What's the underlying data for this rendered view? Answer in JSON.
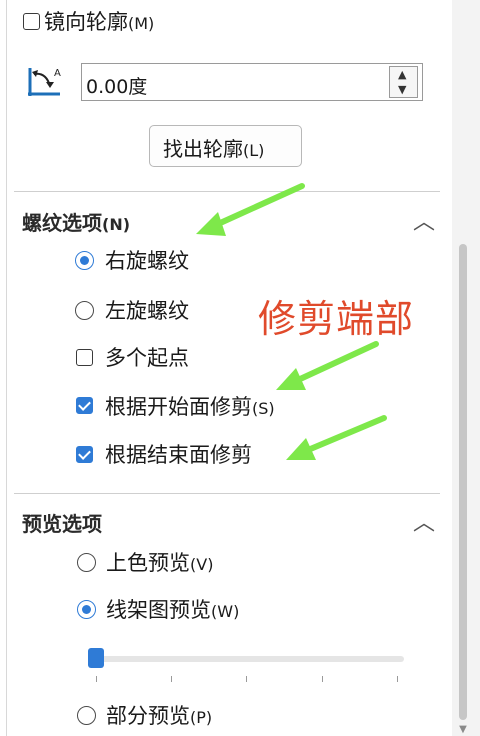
{
  "mirror_profile": {
    "label": "镜向轮廓",
    "shortcut": "(M)",
    "checked": false
  },
  "angle": {
    "value": "0.00度",
    "icon": "angle-icon"
  },
  "find_profile_button": {
    "label": "找出轮廓",
    "shortcut": "(L)"
  },
  "thread_options": {
    "title": "螺纹选项",
    "shortcut": "(N)",
    "right_hand": "右旋螺纹",
    "left_hand": "左旋螺纹",
    "multi_start": "多个起点",
    "trim_start": {
      "label": "根据开始面修剪",
      "shortcut": "(S)",
      "checked": true
    },
    "trim_end": {
      "label": "根据结束面修剪",
      "checked": true
    }
  },
  "preview_options": {
    "title": "预览选项",
    "shaded": {
      "label": "上色预览",
      "shortcut": "(V)"
    },
    "wireframe": {
      "label": "线架图预览",
      "shortcut": "(W)"
    },
    "partial": {
      "label": "部分预览",
      "shortcut": "(P)"
    },
    "slider_level": 0
  },
  "annotation": {
    "text": "修剪端部",
    "color": "#e04a2b",
    "arrow_color": "#7ee84a"
  },
  "accent_color": "#2f7bd6"
}
